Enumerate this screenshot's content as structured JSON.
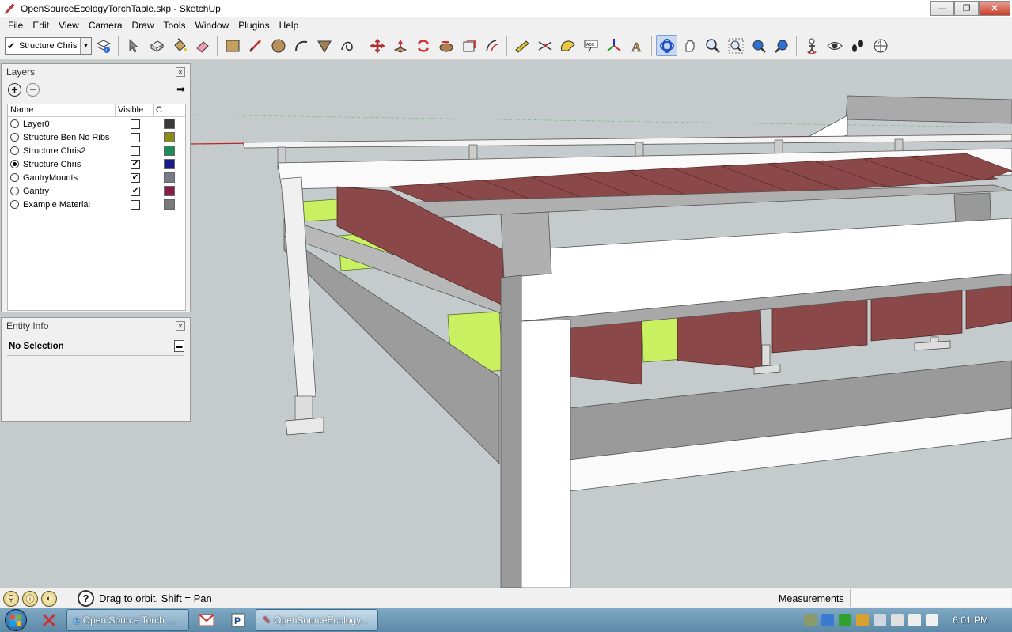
{
  "window": {
    "title": "OpenSourceEcology​TorchTable.skp - SketchUp",
    "min": "—",
    "max": "❐",
    "close": "✕"
  },
  "menu": [
    "File",
    "Edit",
    "View",
    "Camera",
    "Draw",
    "Tools",
    "Window",
    "Plugins",
    "Help"
  ],
  "toolbar": {
    "layer_select": {
      "checked": "✔",
      "value": "Structure Chris"
    },
    "icons": [
      "layers-manager-icon",
      "select-icon",
      "make-component-icon",
      "paint-bucket-icon",
      "eraser-icon",
      "rectangle-icon",
      "line-icon",
      "circle-icon",
      "arc-icon",
      "push-pull-icon",
      "freehand-icon",
      "move-icon",
      "push-pull-up-icon",
      "rotate-icon",
      "follow-me-icon",
      "scale-icon",
      "offset-icon",
      "tape-measure-icon",
      "dimension-icon",
      "protractor-icon",
      "text-icon",
      "axes-icon",
      "3d-text-icon",
      "orbit-icon",
      "pan-icon",
      "zoom-icon",
      "zoom-window-icon",
      "zoom-extents-icon",
      "previous-view-icon",
      "position-camera-icon",
      "look-around-icon",
      "walk-icon",
      "section-plane-icon"
    ]
  },
  "layers_panel": {
    "title": "Layers",
    "columns": [
      "Name",
      "Visible",
      "C"
    ],
    "rows": [
      {
        "name": "Layer0",
        "active": false,
        "visible": false,
        "color": "#3a3a3a"
      },
      {
        "name": "Structure Ben No Ribs",
        "active": false,
        "visible": false,
        "color": "#8a8a1e"
      },
      {
        "name": "Structure Chris2",
        "active": false,
        "visible": false,
        "color": "#1e8a5a"
      },
      {
        "name": "Structure Chris",
        "active": true,
        "visible": true,
        "color": "#1a1a8a"
      },
      {
        "name": "GantryMounts",
        "active": false,
        "visible": true,
        "color": "#7a7a8a"
      },
      {
        "name": "Gantry",
        "active": false,
        "visible": true,
        "color": "#8a1a4a"
      },
      {
        "name": "Example Material",
        "active": false,
        "visible": false,
        "color": "#7a7a7a"
      }
    ]
  },
  "entity_panel": {
    "title": "Entity Info",
    "selection": "No Selection"
  },
  "status": {
    "hint": "Drag to orbit.  Shift = Pan",
    "measurements_label": "Measurements"
  },
  "taskbar": {
    "tasks": [
      {
        "label": "Open Source Torch ...",
        "active": false
      },
      {
        "label": "OpenSourceEcology...",
        "active": true
      }
    ],
    "clock": "6:01 PM"
  },
  "colors": {
    "beam": "#f8f8f8",
    "steel_shade": "#a0a0a0",
    "rib": "#8b4848",
    "channel": "#c8f060",
    "sky": "#c5cbcc"
  }
}
